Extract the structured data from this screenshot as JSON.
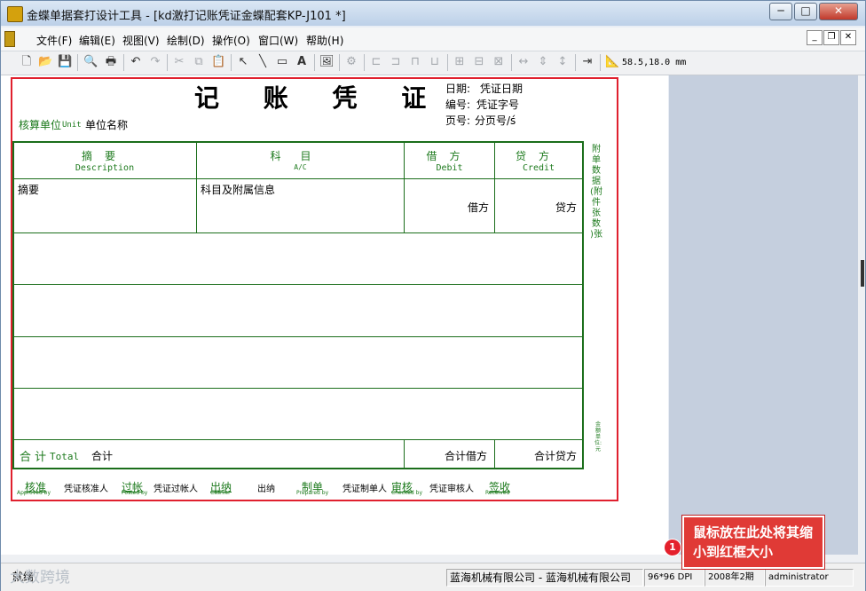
{
  "titlebar": {
    "title": "金蝶单据套打设计工具 - [kd激打记账凭证金蝶配套KP-J101 *]",
    "minimize": "─",
    "maximize": "□",
    "close": "✕"
  },
  "menu": {
    "items": [
      "文件(F)",
      "编辑(E)",
      "视图(V)",
      "绘制(D)",
      "操作(O)",
      "窗口(W)",
      "帮助(H)"
    ],
    "mdi": [
      "_",
      "❐",
      "✕"
    ]
  },
  "toolbar": {
    "coord": "58.5,18.0 mm"
  },
  "voucher": {
    "title": "记 账 凭 证",
    "unit_label": "核算单位",
    "unit_en": "Unit",
    "unit_value": "单位名称",
    "date_label": "日期:",
    "date_value": "凭证日期",
    "num_label": "编号:",
    "num_value": "凭证字号",
    "page_label": "页号:",
    "page_value": "分页号/ś",
    "headers": [
      {
        "zh": "摘要",
        "en": "Description"
      },
      {
        "zh": "科目",
        "en": "A/C"
      },
      {
        "zh": "借方",
        "en": "Debit"
      },
      {
        "zh": "贷方",
        "en": "Credit"
      }
    ],
    "row1": {
      "summary": "摘要",
      "account": "科目及附属信息",
      "debit": "借方",
      "credit": "贷方"
    },
    "total_label": "合 计",
    "total_en": "Total",
    "total_value": "合计",
    "total_debit": "合计借方",
    "total_credit": "合计贷方",
    "side_text": "附单数据(附件张数 )张",
    "side_small": "金额单位:元",
    "signers": [
      {
        "zh": "核准",
        "en": "Approved by",
        "value": "凭证核准人"
      },
      {
        "zh": "过帐",
        "en": "Posted by",
        "value": "凭证过帐人"
      },
      {
        "zh": "出纳",
        "en": "Cashier",
        "value": "出纳"
      },
      {
        "zh": "制单",
        "en": "Prepared by",
        "value": "凭证制单人"
      },
      {
        "zh": "审核",
        "en": "Checked by",
        "value": "凭证审核人"
      },
      {
        "zh": "签收",
        "en": "Received",
        "value": ""
      }
    ]
  },
  "status": {
    "ready": "就绪",
    "company": "蓝海机械有限公司 - 蓝海机械有限公司",
    "dpi": "96*96 DPI",
    "period": "2008年2期",
    "user": "administrator"
  },
  "watermark": "大数跨境",
  "callout": {
    "badge": "1",
    "text": "鼠标放在此处将其缩小到红框大小"
  },
  "colors": {
    "frame": "#e0202e",
    "voucher_green": "#1b6e1b",
    "callout": "#e03a36"
  },
  "icons": [
    "new-icon",
    "open-icon",
    "save-icon",
    "print-preview-icon",
    "print-icon",
    "undo-icon",
    "redo-icon",
    "cut-icon",
    "copy-icon",
    "paste-icon",
    "select-icon",
    "line-icon",
    "rect-icon",
    "text-icon",
    "image-icon",
    "properties-icon",
    "align-left-icon",
    "align-right-icon",
    "align-top-icon",
    "align-bottom-icon",
    "same-width-icon",
    "same-height-icon",
    "same-size-icon",
    "h-spacing-icon",
    "v-spacing-icon",
    "v-distribute-icon",
    "exit-icon",
    "ruler-icon"
  ]
}
